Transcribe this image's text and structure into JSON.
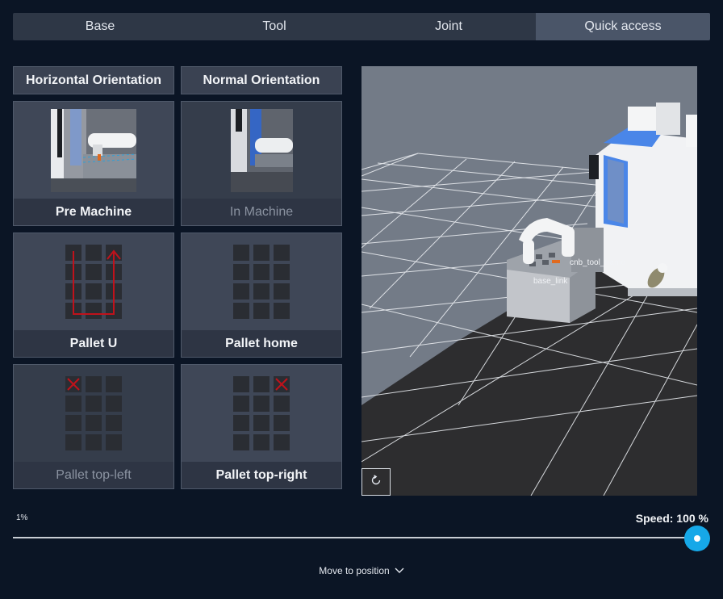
{
  "tabs": [
    {
      "label": "Base",
      "active": false
    },
    {
      "label": "Tool",
      "active": false
    },
    {
      "label": "Joint",
      "active": false
    },
    {
      "label": "Quick access",
      "active": true
    }
  ],
  "orientation": {
    "horizontal_label": "Horizontal Orientation",
    "normal_label": "Normal Orientation"
  },
  "cards": [
    {
      "label": "Pre Machine",
      "enabled": true,
      "icon": "pre-machine-thumbnail"
    },
    {
      "label": "In Machine",
      "enabled": false,
      "icon": "in-machine-thumbnail"
    },
    {
      "label": "Pallet U",
      "enabled": true,
      "icon": "pallet-u-path-icon"
    },
    {
      "label": "Pallet home",
      "enabled": true,
      "icon": "pallet-grid-icon"
    },
    {
      "label": "Pallet top-left",
      "enabled": false,
      "icon": "pallet-top-left-icon"
    },
    {
      "label": "Pallet top-right",
      "enabled": true,
      "icon": "pallet-top-right-icon"
    }
  ],
  "viewport": {
    "labels": {
      "tool_frame": "cnb_tool_frame",
      "base_link": "base_link"
    },
    "reset_icon": "reset-view-icon"
  },
  "speed": {
    "min_label": "1%",
    "label": "Speed: 100 %",
    "value_percent": 100
  },
  "move_to_position": {
    "label": "Move to position",
    "icon": "chevron-down-icon"
  },
  "colors": {
    "accent": "#16a8e8",
    "background": "#0b1525",
    "marker_red": "#c0121b"
  }
}
